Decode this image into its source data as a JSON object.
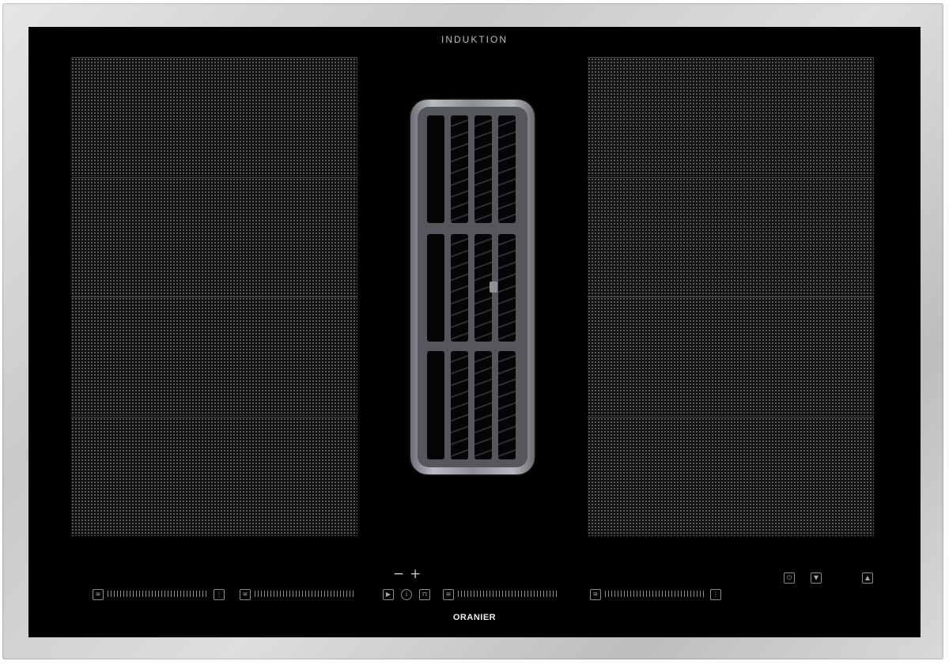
{
  "hob": {
    "top_label": "INDUKTION",
    "brand": "ORANIER"
  },
  "controls": {
    "minus_symbol": "−",
    "plus_symbol": "+"
  },
  "icons": {
    "heat": "heat-wave-icon",
    "bridge": "flex-zone-icon",
    "play": "play-icon",
    "info": "info-icon",
    "lock": "lock-icon",
    "power": "power-icon",
    "down": "arrow-down-icon",
    "up": "arrow-up-icon"
  },
  "colors": {
    "glass": "#000000",
    "frame": "#cfcfcf",
    "vent": "#9a9ca3"
  }
}
